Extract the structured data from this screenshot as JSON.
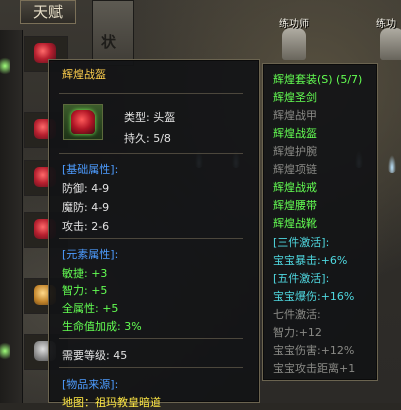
{
  "hud": {
    "talent_tab": "天赋",
    "stone_char": "状",
    "npc_left": "练功师",
    "npc_right": "练功"
  },
  "item": {
    "name": "辉煌战盔",
    "type_label": "类型:",
    "type_value": "头盔",
    "durability_label": "持久:",
    "durability_value": "5/8",
    "base_header": "[基础属性]:",
    "base_stats": [
      {
        "label": "防御:",
        "value": "4-9"
      },
      {
        "label": "魔防:",
        "value": "4-9"
      },
      {
        "label": "攻击:",
        "value": "2-6"
      }
    ],
    "element_header": "[元素属性]:",
    "element_stats": [
      {
        "label": "敏捷:",
        "value": "+3"
      },
      {
        "label": "智力:",
        "value": "+5"
      },
      {
        "label": "全属性:",
        "value": "+5"
      },
      {
        "label": "生命值加成:",
        "value": "3%"
      }
    ],
    "level_label": "需要等级:",
    "level_value": "45",
    "source_header": "[物品来源]:",
    "source_text": "地图：祖玛教皇暗道"
  },
  "set": {
    "title": "辉煌套装(S) (5/7)",
    "pieces": [
      {
        "name": "辉煌圣剑",
        "owned": true
      },
      {
        "name": "辉煌战甲",
        "owned": false
      },
      {
        "name": "辉煌战盔",
        "owned": true
      },
      {
        "name": "辉煌护腕",
        "owned": false
      },
      {
        "name": "辉煌项链",
        "owned": false
      },
      {
        "name": "辉煌战戒",
        "owned": true
      },
      {
        "name": "辉煌腰带",
        "owned": true
      },
      {
        "name": "辉煌战靴",
        "owned": true
      }
    ],
    "bonus3_header": "[三件激活]:",
    "bonus3_value": "宝宝暴击:+6%",
    "bonus5_header": "[五件激活]:",
    "bonus5_value": "宝宝爆伤:+16%",
    "bonus7_header": "七件激活:",
    "bonus7_values": [
      "智力:+12",
      "宝宝伤害:+12%",
      "宝宝攻击距离+1"
    ]
  },
  "colors": {
    "title_gold": "#ffd04d",
    "header_blue": "#4d9cff",
    "bonus_green": "#63ff52",
    "inactive_grey": "#8a8a86",
    "active_cyan": "#4fd8e0",
    "map_yellow": "#ffe844"
  }
}
